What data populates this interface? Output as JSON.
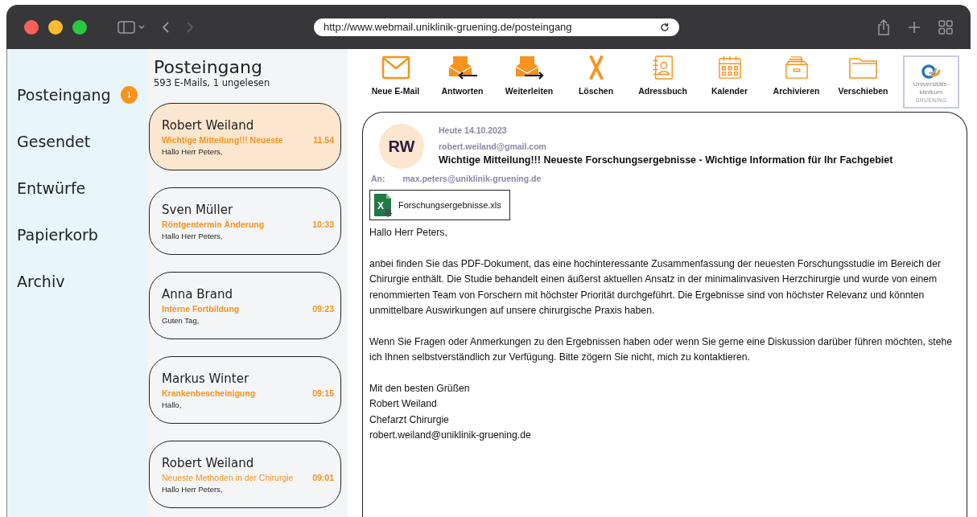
{
  "browser": {
    "url": "http://www.webmail.uniklinik-gruening.de/posteingang"
  },
  "sidebar": {
    "items": [
      {
        "label": "Posteingang",
        "badge": "1"
      },
      {
        "label": "Gesendet"
      },
      {
        "label": "Entwürfe"
      },
      {
        "label": "Papierkorb"
      },
      {
        "label": "Archiv"
      }
    ]
  },
  "list": {
    "title": "Posteingang",
    "subtitle": "593 E-Mails, 1 ungelesen",
    "emails": [
      {
        "sender": "Robert Weiland",
        "subject": "Wichtige Mitteilung!!! Neueste",
        "time": "11.54",
        "preview": "Hallo Herr Peters,",
        "selected": true,
        "subject_bold": true
      },
      {
        "sender": "Sven Müller",
        "subject": "Röntgentermin Änderung",
        "time": "10:33",
        "preview": "Hallo Herr Peters,",
        "selected": false,
        "subject_bold": true
      },
      {
        "sender": "Anna Brand",
        "subject": "Interne Fortbildung",
        "time": "09:23",
        "preview": "Guten Tag,",
        "selected": false,
        "subject_bold": true
      },
      {
        "sender": "Markus Winter",
        "subject": "Krankenbescheinigung",
        "time": "09:15",
        "preview": "Hallo,",
        "selected": false,
        "subject_bold": true
      },
      {
        "sender": "Robert Weiland",
        "subject": "Neueste Methoden in der Chirurgie",
        "time": "09:01",
        "preview": "Hallo Herr Peters,",
        "selected": false,
        "subject_bold": false
      }
    ]
  },
  "toolbar": [
    {
      "kind": "mail",
      "label": "Neue E-Mail"
    },
    {
      "kind": "reply",
      "label": "Antworten"
    },
    {
      "kind": "forward",
      "label": "Weiterleiten"
    },
    {
      "kind": "delete",
      "label": "Löschen"
    },
    {
      "kind": "contacts",
      "label": "Adressbuch"
    },
    {
      "kind": "calendar",
      "label": "Kalender"
    },
    {
      "kind": "archive",
      "label": "Archivieren"
    },
    {
      "kind": "folder",
      "label": "Verschieben"
    }
  ],
  "logo": {
    "lines": [
      "Universitäts-",
      "klinikum"
    ],
    "tagline": "GRUENING"
  },
  "message": {
    "initials": "RW",
    "date": "Heute 14.10.2023",
    "from": "robert.weiland@gmail.com",
    "subject": "Wichtige Mitteilung!!! Neueste Forschungsergebnisse - Wichtige Information für Ihr Fachgebiet",
    "to_label": "An:",
    "to": "max.peters@uniklinik-gruening.de",
    "attachment": {
      "icon_letter": "X",
      "name": "Forschungsergebnisse.xls"
    },
    "body": [
      [
        "Hallo Herr Peters,"
      ],
      [
        "anbei finden Sie das PDF-Dokument, das eine hochinteressante Zusammenfassung der neuesten Forschungsstudie im Bereich der Chirurgie enthält. Die Studie behandelt einen äußerst aktuellen Ansatz in der minimalinvasiven Herzchirurgie und wurde von einem renommierten Team von Forschern mit höchster Priorität durchgeführt. Die Ergebnisse sind von höchster Relevanz und könnten unmittelbare Auswirkungen auf unsere chirurgische Praxis haben."
      ],
      [
        "Wenn Sie Fragen oder Anmerkungen zu den Ergebnissen haben oder wenn Sie gerne eine Diskussion darüber führen möchten, stehe ich Ihnen selbstverständlich zur Verfügung. Bitte zögern Sie nicht, mich zu kontaktieren."
      ],
      [
        "Mit den besten Grüßen",
        "Robert Weiland",
        "Chefarzt Chirurgie",
        "robert.weiland@uniklinik-gruening.de"
      ]
    ]
  }
}
